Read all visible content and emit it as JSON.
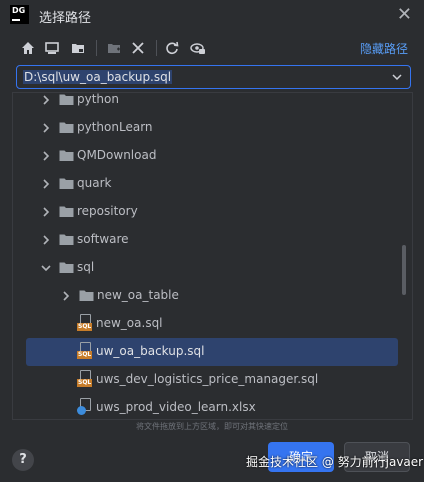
{
  "window": {
    "logo_text_top": "DG",
    "title": "选择路径",
    "close_glyph": "✕"
  },
  "toolbar": {
    "icons": [
      "home-icon",
      "desktop-icon",
      "project-folder-icon",
      "new-folder-icon",
      "delete-icon",
      "refresh-icon",
      "show-hidden-icon"
    ],
    "hide_path_label": "隐藏路径"
  },
  "path": {
    "value": "D:\\sql\\uw_oa_backup.sql"
  },
  "tree": {
    "items": [
      {
        "label": "python",
        "type": "folder",
        "level": 1,
        "expanded": false
      },
      {
        "label": "pythonLearn",
        "type": "folder",
        "level": 1,
        "expanded": false
      },
      {
        "label": "QMDownload",
        "type": "folder",
        "level": 1,
        "expanded": false
      },
      {
        "label": "quark",
        "type": "folder",
        "level": 1,
        "expanded": false
      },
      {
        "label": "repository",
        "type": "folder",
        "level": 1,
        "expanded": false
      },
      {
        "label": "software",
        "type": "folder",
        "level": 1,
        "expanded": false
      },
      {
        "label": "sql",
        "type": "folder",
        "level": 1,
        "expanded": true
      },
      {
        "label": "new_oa_table",
        "type": "folder",
        "level": 2,
        "expanded": false
      },
      {
        "label": "new_oa.sql",
        "type": "sql",
        "level": 2
      },
      {
        "label": "uw_oa_backup.sql",
        "type": "sql",
        "level": 2,
        "selected": true
      },
      {
        "label": "uws_dev_logistics_price_manager.sql",
        "type": "sql",
        "level": 2
      },
      {
        "label": "uws_prod_video_learn.xlsx",
        "type": "xlsx",
        "level": 2
      }
    ]
  },
  "hint": "将文件拖放到上方区域，即可对其快速定位",
  "footer": {
    "help_label": "?",
    "ok_label": "确定",
    "cancel_label": "取消",
    "watermark": "掘金技术社区 @ 努力前行javaer"
  },
  "colors": {
    "background": "#2b2d30",
    "accent": "#3574f0",
    "selection": "#2e436e",
    "link": "#589df6",
    "folder": "#9aa0a6",
    "sql_tag": "#c77d2a"
  }
}
